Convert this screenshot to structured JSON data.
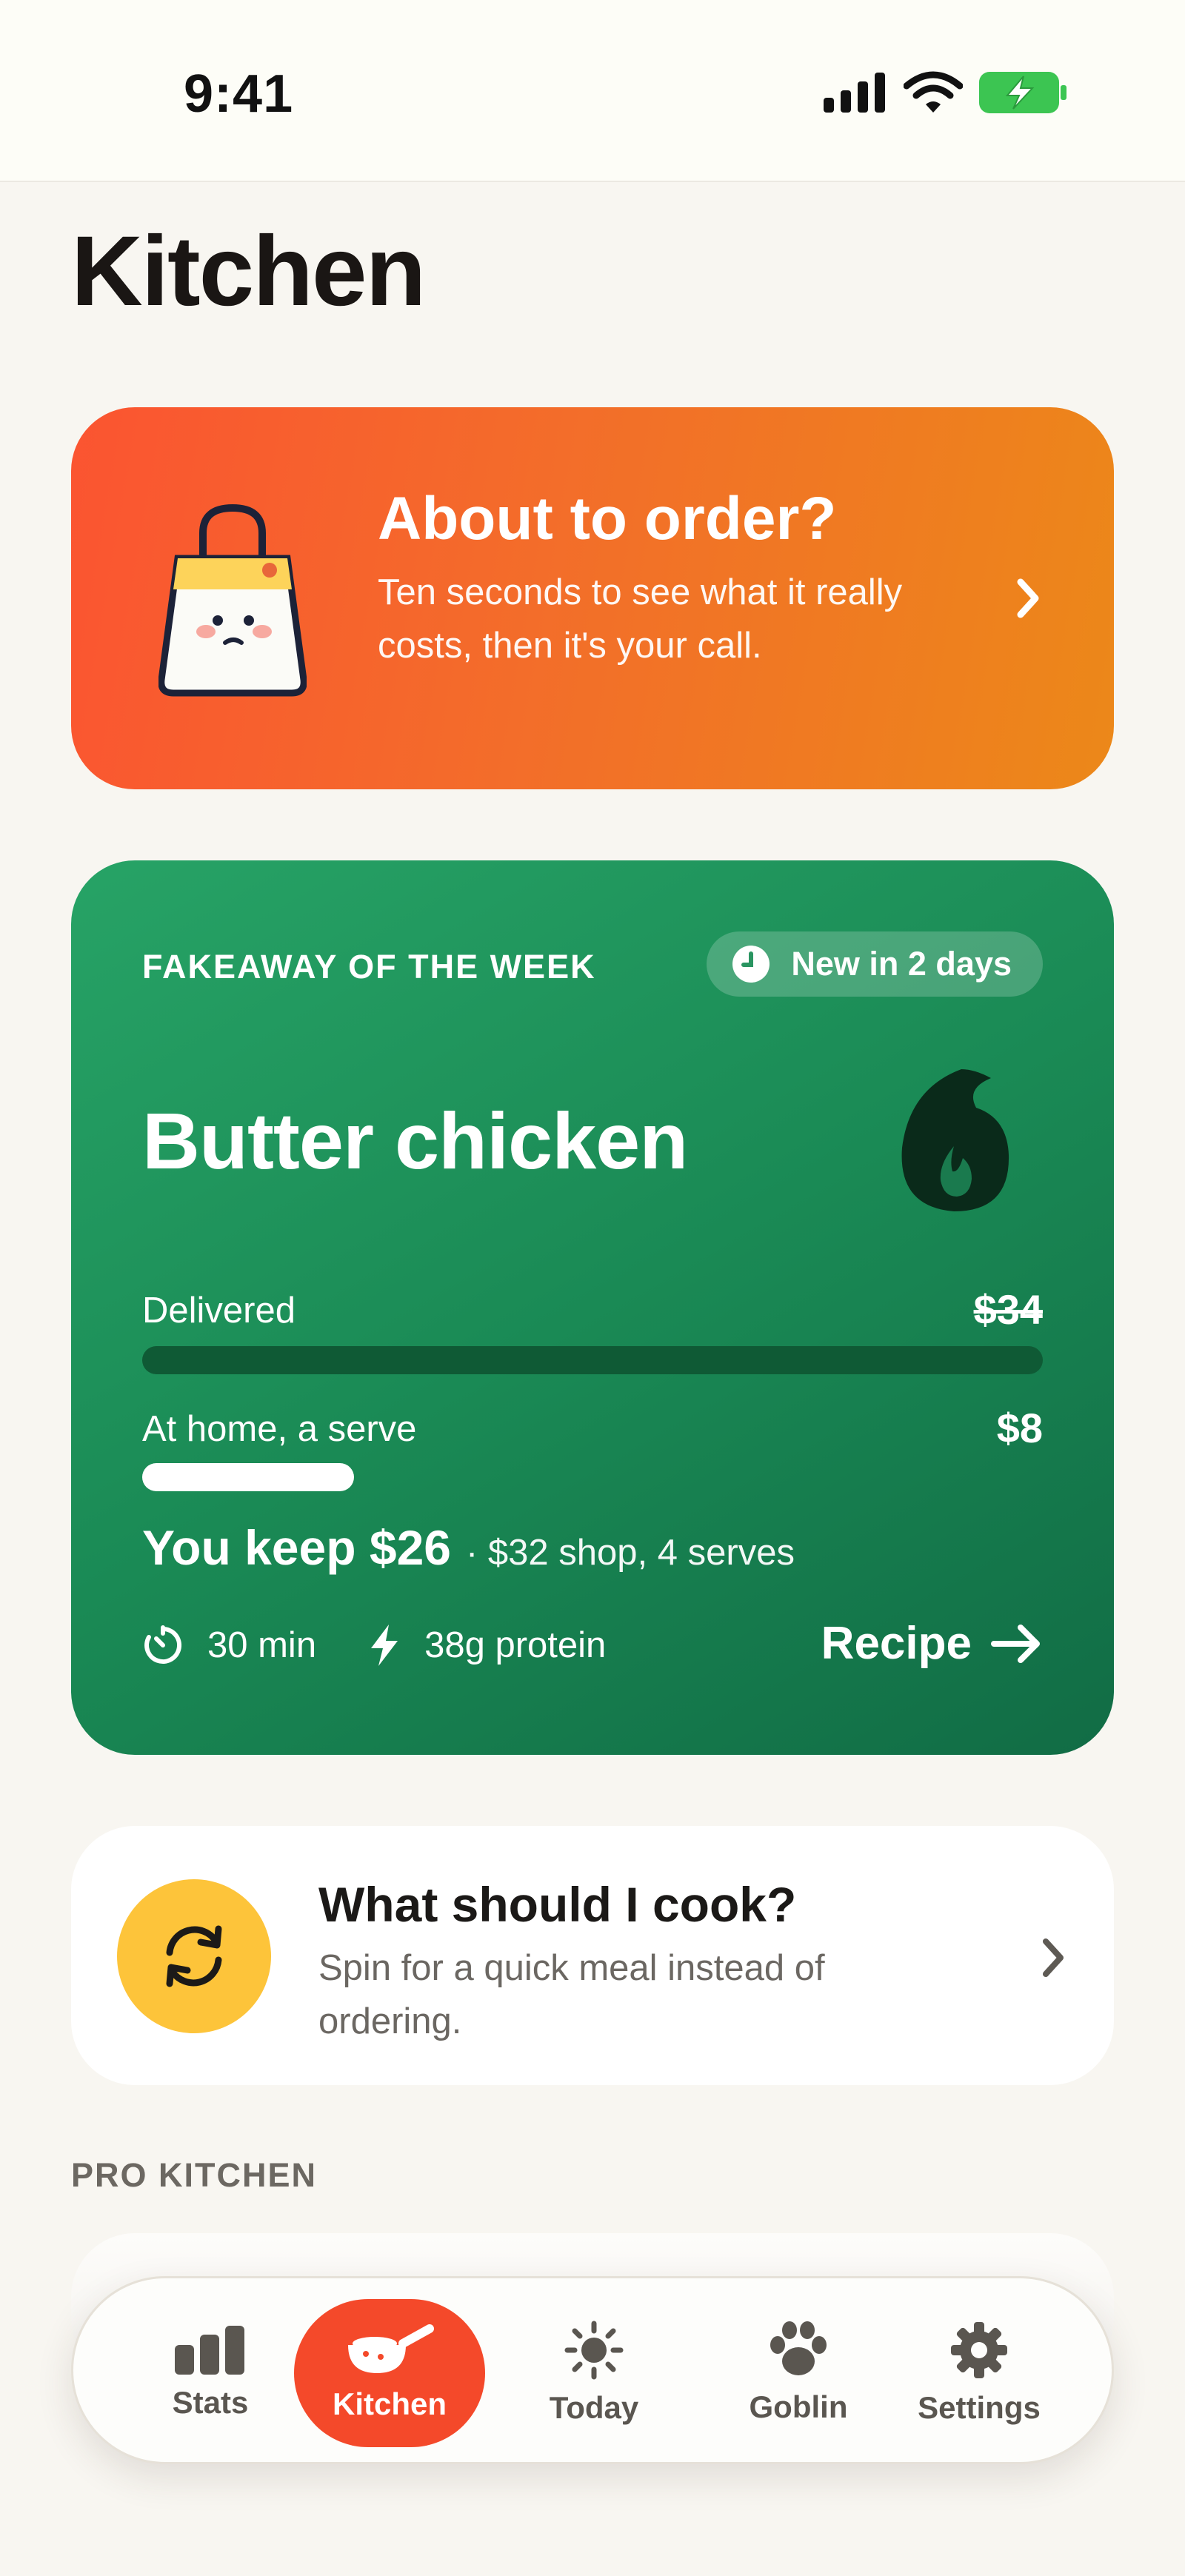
{
  "status": {
    "time": "9:41"
  },
  "page": {
    "title": "Kitchen"
  },
  "order_card": {
    "title": "About to order?",
    "subtitle": "Ten seconds to see what it really costs, then it's your call."
  },
  "fakeaway": {
    "label": "FAKEAWAY OF THE WEEK",
    "badge": "New in 2 days",
    "dish": "Butter chicken",
    "delivered_label": "Delivered",
    "delivered_price": "$34",
    "home_label": "At home, a serve",
    "home_price": "$8",
    "home_fraction": 0.235,
    "keep_main": "You keep $26",
    "keep_sub": "· $32 shop, 4 serves",
    "time": "30 min",
    "protein": "38g protein",
    "recipe_label": "Recipe"
  },
  "cook_card": {
    "title": "What should I cook?",
    "subtitle": "Spin for a quick meal instead of ordering."
  },
  "section": {
    "pro_label": "PRO KITCHEN"
  },
  "tabs": [
    {
      "label": "Stats",
      "icon": "bar-chart-icon"
    },
    {
      "label": "Kitchen",
      "icon": "pan-icon",
      "active": true
    },
    {
      "label": "Today",
      "icon": "sun-icon"
    },
    {
      "label": "Goblin",
      "icon": "paw-icon"
    },
    {
      "label": "Settings",
      "icon": "gear-icon"
    }
  ],
  "colors": {
    "order_gradient_start": "#fb5431",
    "order_gradient_end": "#ec8819",
    "fakeaway_green": "#1a8a55",
    "active_tab": "#f4492a",
    "spin_yellow": "#fdc43a"
  }
}
